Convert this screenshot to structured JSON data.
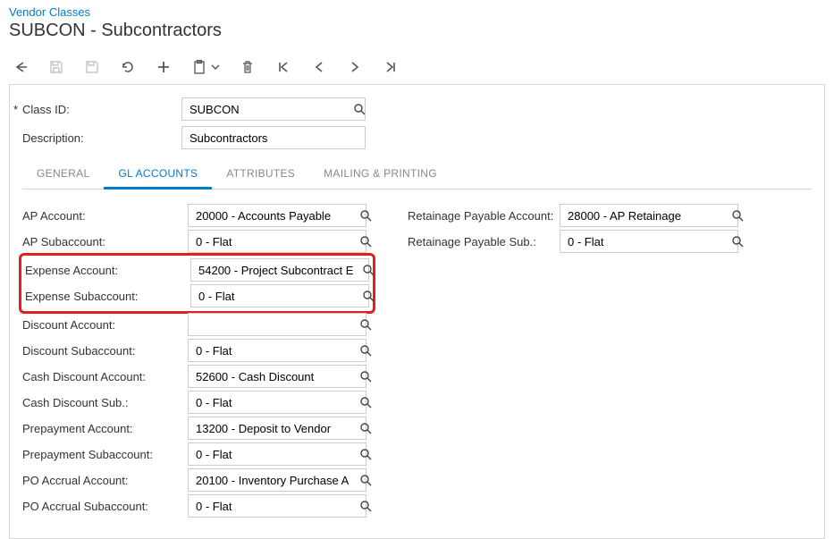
{
  "breadcrumb": "Vendor Classes",
  "page_title": "SUBCON - Subcontractors",
  "top": {
    "class_id_label": "Class ID:",
    "class_id_value": "SUBCON",
    "description_label": "Description:",
    "description_value": "Subcontractors"
  },
  "tabs": {
    "general": "GENERAL",
    "gl": "GL ACCOUNTS",
    "attributes": "ATTRIBUTES",
    "mailing": "MAILING & PRINTING"
  },
  "left": [
    {
      "label": "AP Account:",
      "value": "20000 - Accounts Payable"
    },
    {
      "label": "AP Subaccount:",
      "value": "0 - Flat"
    },
    {
      "label": "Expense Account:",
      "value": "54200 - Project Subcontract E",
      "hi": true
    },
    {
      "label": "Expense Subaccount:",
      "value": "0 - Flat",
      "hi": true
    },
    {
      "label": "Discount Account:",
      "value": ""
    },
    {
      "label": "Discount Subaccount:",
      "value": "0 - Flat"
    },
    {
      "label": "Cash Discount Account:",
      "value": "52600 - Cash Discount"
    },
    {
      "label": "Cash Discount Sub.:",
      "value": "0 - Flat"
    },
    {
      "label": "Prepayment Account:",
      "value": "13200 - Deposit to Vendor"
    },
    {
      "label": "Prepayment Subaccount:",
      "value": "0 - Flat"
    },
    {
      "label": "PO Accrual Account:",
      "value": "20100 - Inventory Purchase A"
    },
    {
      "label": "PO Accrual Subaccount:",
      "value": "0 - Flat"
    }
  ],
  "right": [
    {
      "label": "Retainage Payable Account:",
      "value": "28000 - AP Retainage"
    },
    {
      "label": "Retainage Payable Sub.:",
      "value": "0 - Flat"
    }
  ]
}
